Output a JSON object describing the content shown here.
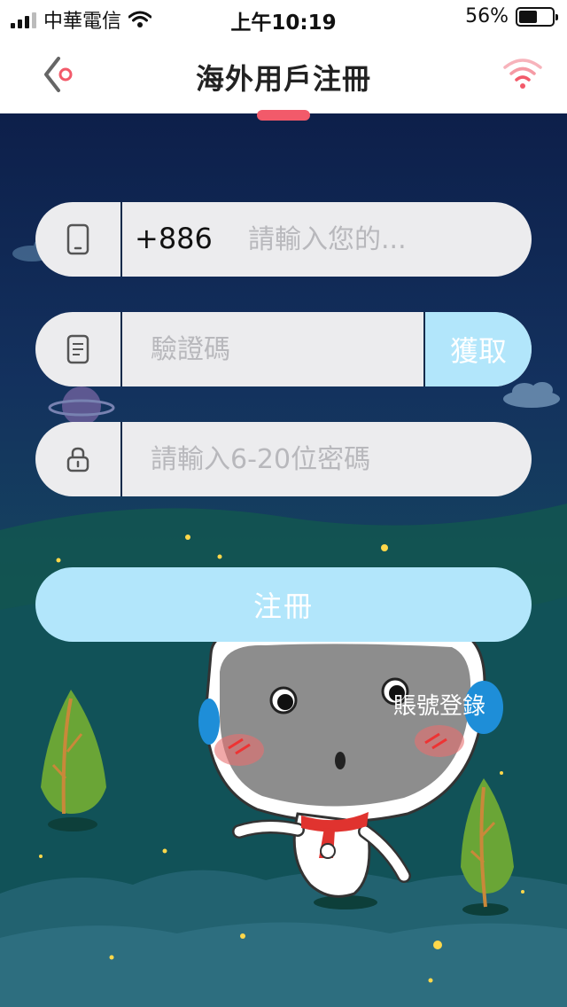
{
  "status_bar": {
    "carrier": "中華電信",
    "time": "上午10:19",
    "battery_percent": "56%",
    "battery_level": 0.56
  },
  "nav": {
    "title": "海外用戶注冊",
    "back_icon": "back-chevron-icon",
    "right_icon": "wifi-icon",
    "accent_color": "#f25a6a"
  },
  "form": {
    "phone": {
      "icon": "phone-icon",
      "country_code": "+886",
      "placeholder": "請輸入您的...",
      "value": ""
    },
    "code": {
      "icon": "document-icon",
      "placeholder": "驗證碼",
      "value": "",
      "get_button_label": "獲取"
    },
    "password": {
      "icon": "lock-icon",
      "placeholder": "請輸入6-20位密碼",
      "value": ""
    },
    "register_label": "注冊",
    "login_link": "賬號登錄",
    "button_color": "#b2e6fb"
  }
}
